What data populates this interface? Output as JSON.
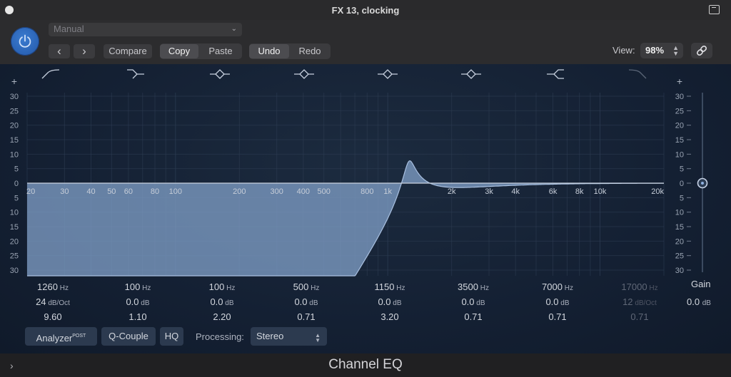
{
  "window": {
    "title": "FX 13, clocking"
  },
  "header": {
    "preset": "Manual",
    "prev_label": "‹",
    "next_label": "›",
    "compare_label": "Compare",
    "copy_label": "Copy",
    "paste_label": "Paste",
    "undo_label": "Undo",
    "redo_label": "Redo",
    "view_label": "View:",
    "view_value": "98%"
  },
  "eq": {
    "db_ticks_top": [
      "30",
      "25",
      "20",
      "15",
      "10",
      "5",
      "0"
    ],
    "db_ticks_bottom": [
      "5",
      "10",
      "15",
      "20",
      "25",
      "30"
    ],
    "freq_labels": [
      "20",
      "30",
      "40",
      "50",
      "60",
      "80",
      "100",
      "200",
      "300",
      "400",
      "500",
      "800",
      "1k",
      "2k",
      "3k",
      "4k",
      "6k",
      "8k",
      "10k",
      "20k"
    ],
    "freq_values": [
      20,
      30,
      40,
      50,
      60,
      80,
      100,
      200,
      300,
      400,
      500,
      800,
      1000,
      2000,
      3000,
      4000,
      6000,
      8000,
      10000,
      20000
    ],
    "bands": [
      {
        "shape": "low-cut",
        "freq": "1260",
        "freq_unit": "Hz",
        "gain": "24",
        "gain_unit": "dB/Oct",
        "q": "9.60",
        "enabled": true
      },
      {
        "shape": "low-shelf",
        "freq": "100",
        "freq_unit": "Hz",
        "gain": "0.0",
        "gain_unit": "dB",
        "q": "1.10",
        "enabled": true
      },
      {
        "shape": "bell",
        "freq": "100",
        "freq_unit": "Hz",
        "gain": "0.0",
        "gain_unit": "dB",
        "q": "2.20",
        "enabled": true
      },
      {
        "shape": "bell",
        "freq": "500",
        "freq_unit": "Hz",
        "gain": "0.0",
        "gain_unit": "dB",
        "q": "0.71",
        "enabled": true
      },
      {
        "shape": "bell",
        "freq": "1150",
        "freq_unit": "Hz",
        "gain": "0.0",
        "gain_unit": "dB",
        "q": "3.20",
        "enabled": true
      },
      {
        "shape": "bell",
        "freq": "3500",
        "freq_unit": "Hz",
        "gain": "0.0",
        "gain_unit": "dB",
        "q": "0.71",
        "enabled": true
      },
      {
        "shape": "high-shelf",
        "freq": "7000",
        "freq_unit": "Hz",
        "gain": "0.0",
        "gain_unit": "dB",
        "q": "0.71",
        "enabled": true
      },
      {
        "shape": "high-cut",
        "freq": "17000",
        "freq_unit": "Hz",
        "gain": "12",
        "gain_unit": "dB/Oct",
        "q": "0.71",
        "enabled": false
      }
    ],
    "gain_label": "Gain",
    "gain_value": "0.0",
    "gain_unit": "dB",
    "gain_slider_db": 0,
    "colors": {
      "curve_fill": "#7e9cc4",
      "grid": "#2e3d53",
      "zero_line": "#c9d2e0"
    }
  },
  "options": {
    "analyzer_label": "Analyzer",
    "analyzer_sup": "POST",
    "qcouple_label": "Q-Couple",
    "hq_label": "HQ",
    "processing_label": "Processing:",
    "processing_value": "Stereo"
  },
  "footer": {
    "plugin_name": "Channel EQ"
  }
}
